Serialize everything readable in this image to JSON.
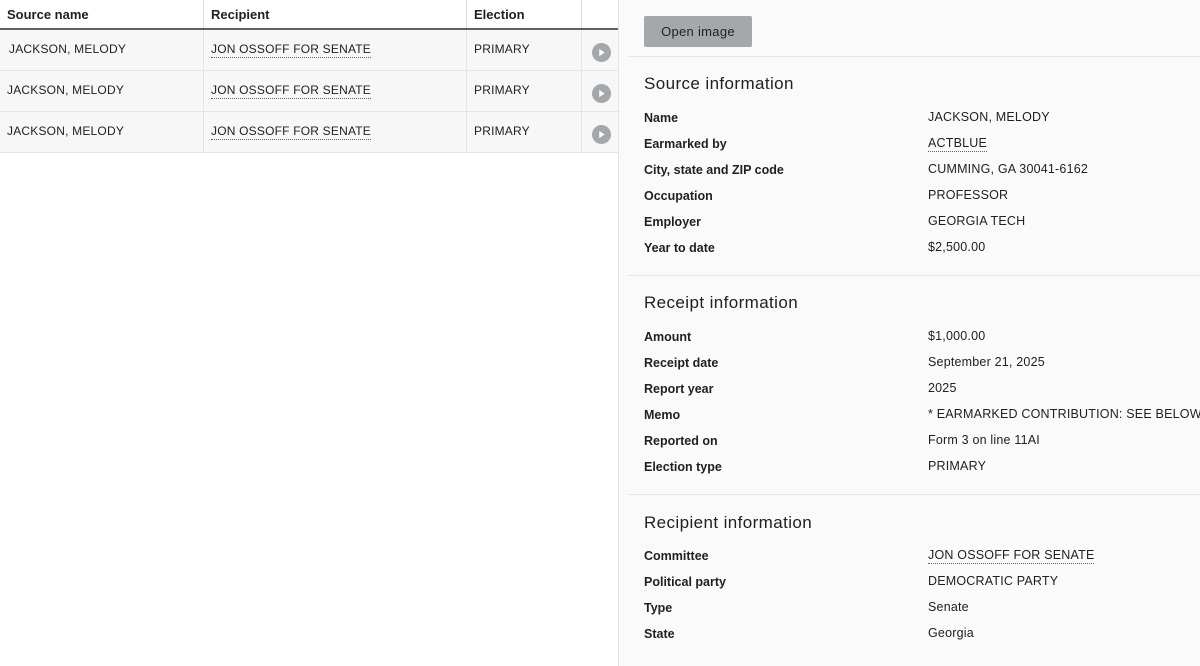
{
  "table": {
    "headers": {
      "source_name": "Source name",
      "recipient": "Recipient",
      "election": "Election"
    },
    "rows": [
      {
        "source_name": "JACKSON, MELODY",
        "recipient": "JON OSSOFF FOR SENATE",
        "election": "PRIMARY"
      },
      {
        "source_name": "JACKSON, MELODY",
        "recipient": "JON OSSOFF FOR SENATE",
        "election": "PRIMARY"
      },
      {
        "source_name": "JACKSON, MELODY",
        "recipient": "JON OSSOFF FOR SENATE",
        "election": "PRIMARY"
      }
    ]
  },
  "detail": {
    "open_image_label": "Open image",
    "source": {
      "title": "Source information",
      "fields": [
        {
          "label": "Name",
          "value": "JACKSON, MELODY"
        },
        {
          "label": "Earmarked by",
          "value": "ACTBLUE"
        },
        {
          "label": "City, state and ZIP code",
          "value": "CUMMING, GA 30041-6162"
        },
        {
          "label": "Occupation",
          "value": "PROFESSOR"
        },
        {
          "label": "Employer",
          "value": "GEORGIA TECH"
        },
        {
          "label": "Year to date",
          "value": "$2,500.00"
        }
      ]
    },
    "receipt": {
      "title": "Receipt information",
      "fields": [
        {
          "label": "Amount",
          "value": "$1,000.00"
        },
        {
          "label": "Receipt date",
          "value": "September 21, 2025"
        },
        {
          "label": "Report year",
          "value": "2025"
        },
        {
          "label": "Memo",
          "value": "* EARMARKED CONTRIBUTION: SEE BELOW"
        },
        {
          "label": "Reported on",
          "value": "Form 3 on line 11AI"
        },
        {
          "label": "Election type",
          "value": "PRIMARY"
        }
      ]
    },
    "recipient": {
      "title": "Recipient information",
      "fields": [
        {
          "label": "Committee",
          "value": "JON OSSOFF FOR SENATE"
        },
        {
          "label": "Political party",
          "value": "DEMOCRATIC PARTY"
        },
        {
          "label": "Type",
          "value": "Senate"
        },
        {
          "label": "State",
          "value": "Georgia"
        }
      ]
    }
  }
}
